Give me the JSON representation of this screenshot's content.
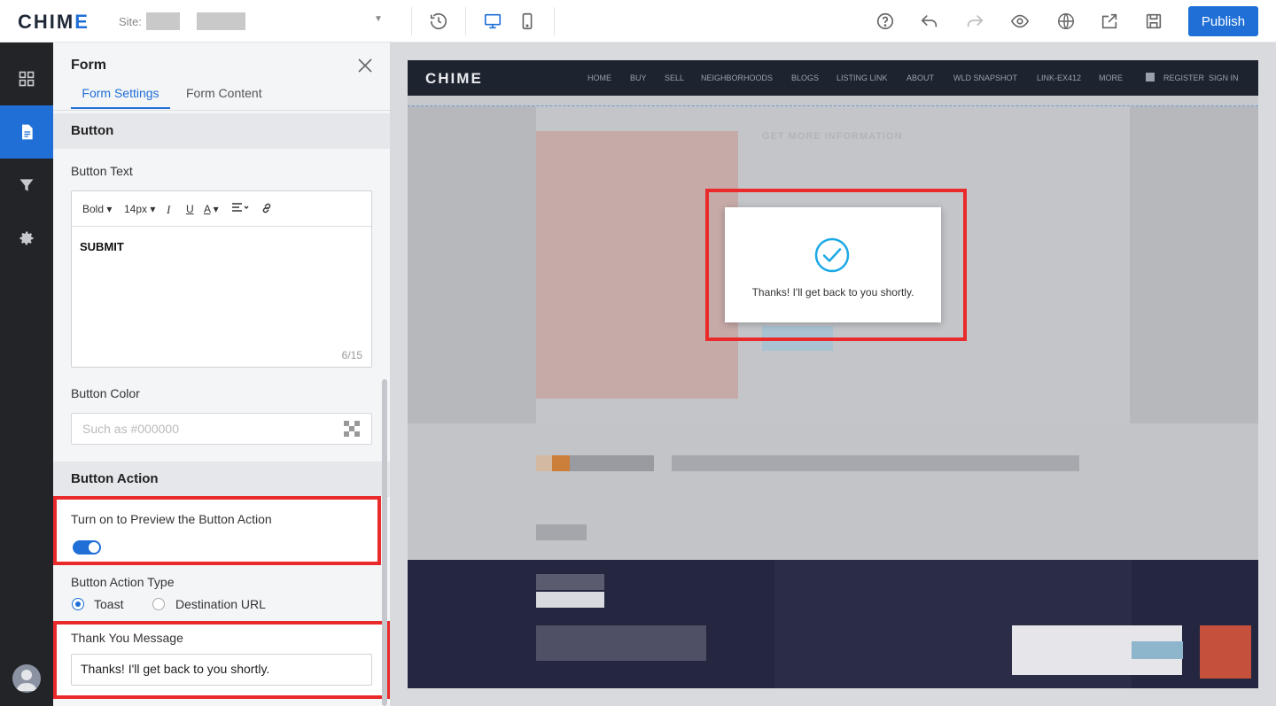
{
  "topbar": {
    "logo": "CHIM",
    "logo_accent": "E",
    "site_label": "Site:",
    "publish_label": "Publish",
    "icons": [
      "history-icon",
      "desktop-icon",
      "mobile-icon",
      "help-icon",
      "undo-icon",
      "redo-icon",
      "preview-eye-icon",
      "globe-icon",
      "export-icon",
      "save-icon"
    ]
  },
  "rail": {
    "items": [
      "dashboard-icon",
      "page-icon",
      "filter-icon",
      "settings-gear-icon"
    ],
    "active": "page-icon"
  },
  "panel": {
    "title": "Form",
    "tabs": [
      {
        "label": "Form Settings",
        "active": true
      },
      {
        "label": "Form Content",
        "active": false
      }
    ],
    "button_section": {
      "heading": "Button",
      "text_label": "Button Text",
      "toolbar": {
        "weight": "Bold",
        "size": "14px",
        "italic": "I",
        "underline": "U",
        "color": "A"
      },
      "text_value": "SUBMIT",
      "char_count": "6/15",
      "color_label": "Button Color",
      "color_placeholder": "Such as #000000"
    },
    "action_section": {
      "heading": "Button Action",
      "preview_label": "Turn on to Preview the Button Action",
      "preview_on": true,
      "type_label": "Button Action Type",
      "types": [
        {
          "label": "Toast",
          "selected": true
        },
        {
          "label": "Destination URL",
          "selected": false
        }
      ],
      "thank_you_label": "Thank You Message",
      "thank_you_value": "Thanks! I'll get back to you shortly."
    }
  },
  "preview": {
    "site_logo": "CHIME",
    "nav": [
      "HOME",
      "BUY",
      "SELL",
      "NEIGHBORHOODS",
      "BLOGS",
      "LISTING LINK",
      "ABOUT",
      "WLD SNAPSHOT",
      "LINK-EX412",
      "MORE"
    ],
    "register": "REGISTER",
    "sign_in": "SIGN IN",
    "form_heading": "GET MORE INFORMATION",
    "toast_message": "Thanks! I'll get back to you shortly.",
    "accent_color": "#1f6fd6",
    "highlight_color": "#ea2a2a",
    "check_color": "#1ca9e6"
  }
}
